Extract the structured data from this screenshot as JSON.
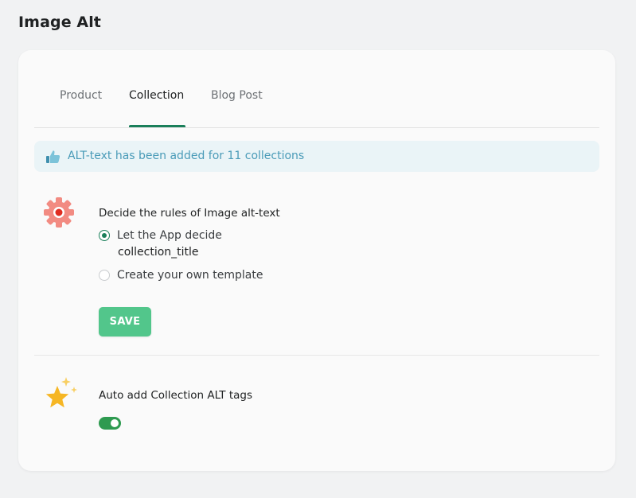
{
  "page": {
    "title": "Image Alt"
  },
  "tabs": [
    {
      "label": "Product",
      "active": false
    },
    {
      "label": "Collection",
      "active": true
    },
    {
      "label": "Blog Post",
      "active": false
    }
  ],
  "banner": {
    "text": "ALT-text has been added for 11 collections",
    "icon": "thumbs-up-icon"
  },
  "rules": {
    "icon": "gear-icon",
    "title": "Decide the rules of Image alt-text",
    "options": [
      {
        "label": "Let the App decide",
        "checked": true
      },
      {
        "label": "Create your own template",
        "checked": false
      }
    ],
    "value": "collection_title",
    "save_label": "SAVE"
  },
  "auto_tags": {
    "icon": "sparkle-star-icon",
    "title": "Auto add Collection ALT tags",
    "enabled": true
  },
  "colors": {
    "accent": "#1a7f5a",
    "save_button": "#52c68b",
    "banner_bg": "#eaf4f7",
    "banner_text": "#4a9bb8",
    "toggle_on": "#2e9a50"
  }
}
